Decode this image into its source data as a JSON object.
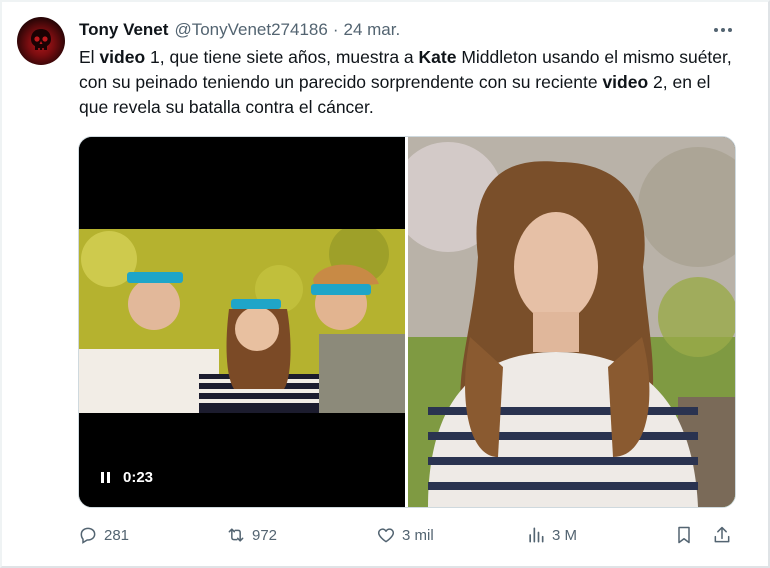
{
  "tweet": {
    "author_name": "Tony Venet",
    "author_handle": "@TonyVenet274186",
    "separator": "·",
    "date": "24 mar.",
    "text": {
      "p1": "El ",
      "b1": "video",
      "p2": " 1, que tiene siete años, muestra a ",
      "b2": "Kate",
      "p3": " Middleton usando el mismo suéter, con su peinado teniendo un parecido sorprendente con su reciente ",
      "b3": "video",
      "p4": " 2, en el que revela su batalla contra el cáncer."
    }
  },
  "media": {
    "video_time": "0:23"
  },
  "actions": {
    "replies": "281",
    "reposts": "972",
    "likes": "3 mil",
    "views": "3 M"
  },
  "icons": [
    "more-icon",
    "pause-icon",
    "reply-icon",
    "repost-icon",
    "like-icon",
    "views-icon",
    "bookmark-icon",
    "share-icon"
  ],
  "colors": {
    "text": "#0f1419",
    "muted": "#536471",
    "border": "#cfd9de"
  }
}
